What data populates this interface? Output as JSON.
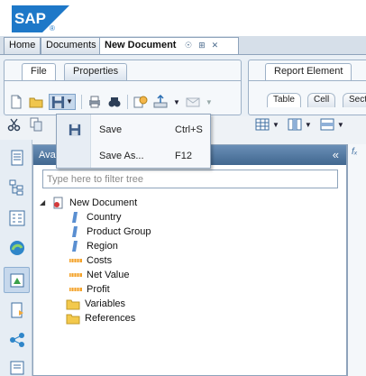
{
  "brand": {
    "logo_text": "SAP",
    "registered": "®",
    "color": "#1e78c8"
  },
  "document_tabs": [
    {
      "label": "Home"
    },
    {
      "label": "Documents"
    },
    {
      "label": "New Document",
      "active": true
    }
  ],
  "ribbon_left": {
    "tabs": [
      {
        "label": "File",
        "active": true
      },
      {
        "label": "Properties"
      }
    ]
  },
  "ribbon_right": {
    "tab": "Report Element",
    "subtabs": [
      {
        "label": "Table",
        "active": true
      },
      {
        "label": "Cell"
      },
      {
        "label": "Sect"
      }
    ]
  },
  "save_menu": {
    "items": [
      {
        "label": "Save",
        "shortcut": "Ctrl+S"
      },
      {
        "label": "Save As...",
        "shortcut": "F12"
      }
    ]
  },
  "panel": {
    "title": "Ava",
    "collapse_glyph": "«",
    "filter_placeholder": "Type here to filter tree"
  },
  "tree": {
    "root": "New Document",
    "dimensions": [
      "Country",
      "Product Group",
      "Region"
    ],
    "measures": [
      "Costs",
      "Net Value",
      "Profit"
    ],
    "folders": [
      "Variables",
      "References"
    ]
  },
  "icons": {
    "left_rail": [
      "document-structure-icon",
      "outline-tree-icon",
      "input-controls-icon",
      "data-source-icon",
      "available-objects-icon",
      "report-filter-icon",
      "shared-elements-icon",
      "comments-icon"
    ]
  }
}
